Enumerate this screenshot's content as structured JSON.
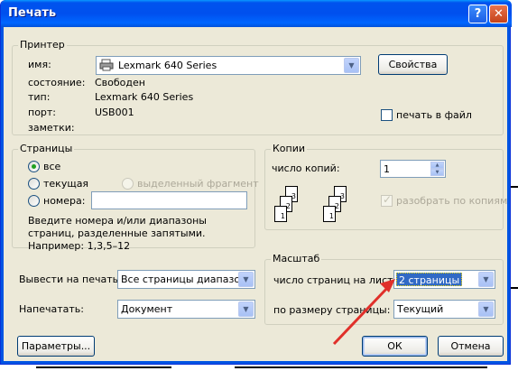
{
  "dialog": {
    "title": "Печать",
    "help_label": "?",
    "close_label": "✕"
  },
  "printer": {
    "legend": "Принтер",
    "name_label": "имя:",
    "name_value": "Lexmark 640 Series",
    "properties_button": "Свойства",
    "status_label": "состояние:",
    "status_value": "Свободен",
    "type_label": "тип:",
    "type_value": "Lexmark 640 Series",
    "port_label": "порт:",
    "port_value": "USB001",
    "notes_label": "заметки:",
    "print_to_file": "печать в файл"
  },
  "pages": {
    "legend": "Страницы",
    "all": "все",
    "current": "текущая",
    "selection": "выделенный фрагмент",
    "numbers": "номера:",
    "hint": "Введите номера и/или диапазоны страниц, разделенные запятыми. Например: 1,3,5–12"
  },
  "copies": {
    "legend": "Копии",
    "count_label": "число копий:",
    "count_value": "1",
    "collate_label": "разобрать по копиям",
    "stack_pages": [
      "3",
      "2",
      "1"
    ]
  },
  "print_what": {
    "output_label": "Вывести на печать:",
    "output_value": "Все страницы диапазона",
    "print_label": "Напечатать:",
    "print_value": "Документ"
  },
  "zoom": {
    "legend": "Масштаб",
    "pages_per_sheet_label": "число страниц на листе:",
    "pages_per_sheet_value": "2 страницы",
    "scale_label": "по размеру страницы:",
    "scale_value": "Текущий"
  },
  "buttons": {
    "options": "Параметры...",
    "ok": "ОК",
    "cancel": "Отмена"
  },
  "colors": {
    "annotation_arrow": "#e0302a",
    "titlebar": "#0054e3",
    "selection": "#316ac5"
  }
}
